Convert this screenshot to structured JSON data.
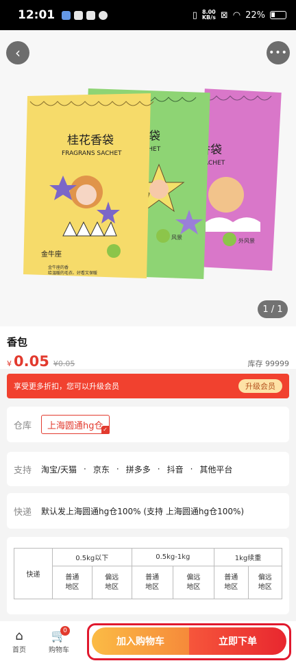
{
  "status_bar": {
    "time": "12:01",
    "net_speed": "8.00",
    "net_unit": "KB/s",
    "battery": "22%"
  },
  "hero": {
    "page_indicator": "1 / 1",
    "packet_texts": {
      "title_cn": "桂花香袋",
      "title_en": "FRAGRANS SACHET",
      "zodiac": "金牛座",
      "desc_line1": "金牛座的香",
      "desc_line2": "给温暖的毛衣、好看又保暖",
      "mid_title": "香袋",
      "mid_en": "CHET",
      "mid_tag": "风景",
      "right_title": "香袋",
      "right_en": "ACHET",
      "right_tag": "外风景"
    }
  },
  "product": {
    "title": "香包",
    "currency": "¥",
    "price": "0.05",
    "original_price": "¥0.05",
    "stock": "库存 99999"
  },
  "promo": {
    "text": "享受更多折扣，您可以升级会员",
    "button": "升级会员"
  },
  "warehouse": {
    "label": "仓库",
    "selected": "上海圆通hg仓"
  },
  "support": {
    "label": "支持",
    "platforms": [
      "淘宝/天猫",
      "京东",
      "拼多多",
      "抖音",
      "其他平台"
    ],
    "separator": "·"
  },
  "express": {
    "label": "快递",
    "text": "默认发上海圆通hg仓100% (支持 上海圆通hg仓100%)"
  },
  "shipping_table": {
    "row_header": "快递",
    "tiers": [
      "0.5kg以下",
      "0.5kg-1kg",
      "1kg续重"
    ],
    "regions": [
      "普通\n地区",
      "偏远\n地区",
      "普通\n地区",
      "偏远\n地区",
      "普通\n地区",
      "偏远\n地区"
    ]
  },
  "bottom_bar": {
    "home": "首页",
    "cart": "购物车",
    "cart_badge": "0",
    "add_to_cart": "加入购物车",
    "buy_now": "立即下单"
  },
  "colors": {
    "accent": "#e23a2e",
    "promo_bg": "#f1412f",
    "cart_gradient": "#f68a3a",
    "buy_gradient": "#e8272f"
  }
}
